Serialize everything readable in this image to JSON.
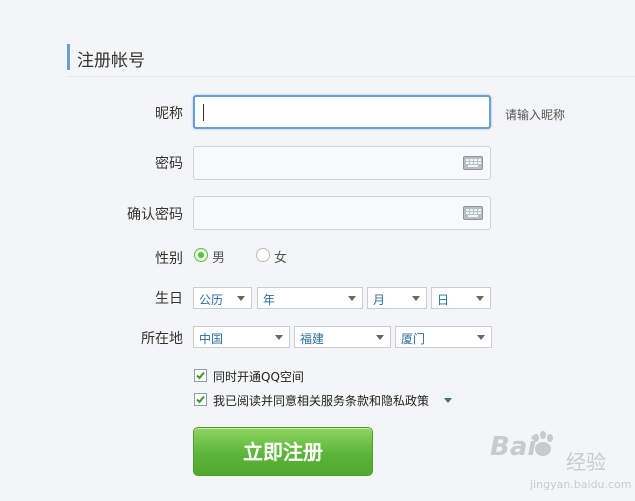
{
  "header": {
    "title": "注册帐号"
  },
  "form": {
    "nickname": {
      "label": "昵称",
      "value": "",
      "hint": "请输入昵称"
    },
    "password": {
      "label": "密码",
      "value": ""
    },
    "confirm_password": {
      "label": "确认密码",
      "value": ""
    },
    "gender": {
      "label": "性别",
      "options": [
        "男",
        "女"
      ],
      "selected": "男"
    },
    "birthday": {
      "label": "生日",
      "calendar": "公历",
      "year": "年",
      "month": "月",
      "day": "日"
    },
    "location": {
      "label": "所在地",
      "country": "中国",
      "province": "福建",
      "city": "厦门"
    },
    "options": [
      {
        "label": "同时开通QQ空间",
        "checked": true
      },
      {
        "label": "我已阅读并同意相关服务条款和隐私政策",
        "checked": true
      }
    ],
    "submit_label": "立即注册"
  },
  "watermark": {
    "logo": "Bai",
    "text": "经验",
    "url": "jingyan.baidu.com"
  },
  "colors": {
    "accent": "#6aa0cf",
    "primary_button": "#5cb53a",
    "link": "#2d6e9e"
  }
}
